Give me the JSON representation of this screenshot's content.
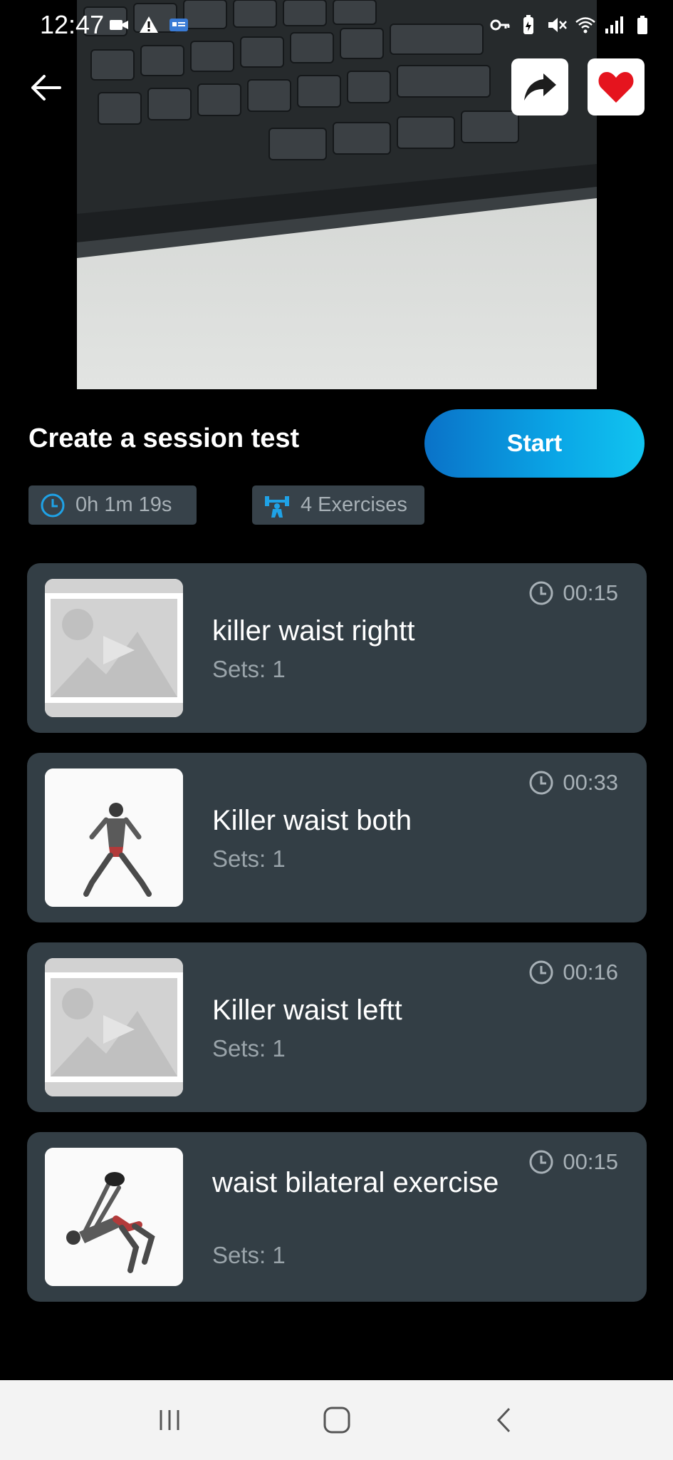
{
  "status_bar": {
    "time": "12:47",
    "left_icons": [
      "video-camera-icon",
      "warning-icon",
      "message-icon"
    ],
    "right_icons": [
      "key-icon",
      "battery-saver-icon",
      "mute-icon",
      "wifi-icon",
      "signal-icon",
      "battery-icon"
    ]
  },
  "header": {
    "back_icon": "arrow-left-icon",
    "share_icon": "share-arrow-icon",
    "favorite_icon": "heart-icon",
    "favorite_color": "#e5141e"
  },
  "session": {
    "title": "Create a session test",
    "start_label": "Start",
    "duration": "0h 1m 19s",
    "exercises_count": "4 Exercises",
    "accent_color": "#1fa2e6"
  },
  "exercises": [
    {
      "name": "killer waist rightt",
      "sets": "Sets: 1",
      "time": "00:15",
      "thumbnail": "placeholder-image"
    },
    {
      "name": "Killer waist both",
      "sets": "Sets: 1",
      "time": "00:33",
      "thumbnail": "exercise-photo"
    },
    {
      "name": "Killer waist leftt",
      "sets": "Sets: 1",
      "time": "00:16",
      "thumbnail": "placeholder-image"
    },
    {
      "name": "waist bilateral exercise",
      "sets": "Sets: 1",
      "time": "00:15",
      "thumbnail": "exercise-photo"
    }
  ],
  "nav_bar": {
    "icons": [
      "recent-apps-icon",
      "home-icon",
      "back-icon"
    ]
  }
}
